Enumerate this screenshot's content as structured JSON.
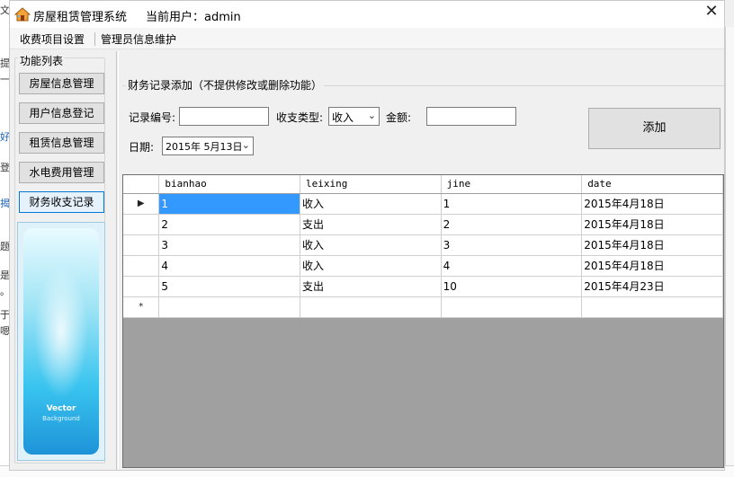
{
  "window": {
    "title": "房屋租赁管理系统",
    "current_user_label": "当前用户：admin",
    "close_label": "✕"
  },
  "menu": {
    "items": [
      "收费项目设置",
      "管理员信息维护"
    ]
  },
  "sidebar": {
    "group_label": "功能列表",
    "buttons": [
      "房屋信息管理",
      "用户信息登记",
      "租赁信息管理",
      "水电费用管理",
      "财务收支记录"
    ],
    "banner_title": "Vector",
    "banner_subtitle": "Background"
  },
  "form": {
    "legend": "财务记录添加（不提供修改或删除功能）",
    "record_no_label": "记录编号:",
    "record_no_value": "",
    "type_label": "收支类型:",
    "type_value": "收入",
    "amount_label": "金额:",
    "amount_value": "",
    "date_label": "日期:",
    "date_value": "2015年 5月13日",
    "add_button": "添加"
  },
  "grid": {
    "columns": [
      "bianhao",
      "leixing",
      "jine",
      "date"
    ],
    "rows": [
      [
        "1",
        "收入",
        "1",
        "2015年4月18日"
      ],
      [
        "2",
        "支出",
        "2",
        "2015年4月18日"
      ],
      [
        "3",
        "收入",
        "3",
        "2015年4月18日"
      ],
      [
        "4",
        "收入",
        "4",
        "2015年4月18日"
      ],
      [
        "5",
        "支出",
        "10",
        "2015年4月23日"
      ]
    ],
    "current_row_marker": "▶",
    "new_row_marker": "*"
  },
  "background_app": {
    "left_chars": [
      "文",
      "提",
      "一",
      "好",
      "登",
      "揭",
      "题",
      "是",
      "。",
      "于",
      "嗯"
    ]
  },
  "colors": {
    "selection": "#3399ff",
    "grid_background": "#a0a0a0"
  }
}
